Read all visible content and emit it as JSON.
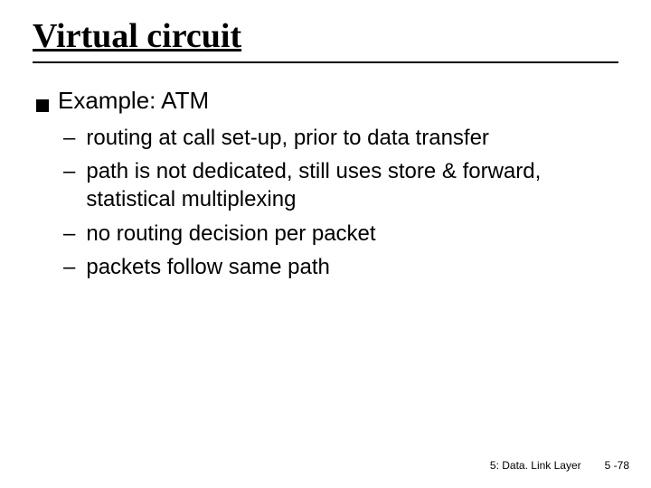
{
  "title": "Virtual circuit",
  "heading": "Example: ATM",
  "bullets": [
    "routing at call set-up, prior to data transfer",
    "path is not dedicated, still uses store & forward, statistical multiplexing",
    "no routing decision per packet",
    "packets follow same path"
  ],
  "footer": {
    "section": "5: Data. Link Layer",
    "page": "5 -78"
  }
}
